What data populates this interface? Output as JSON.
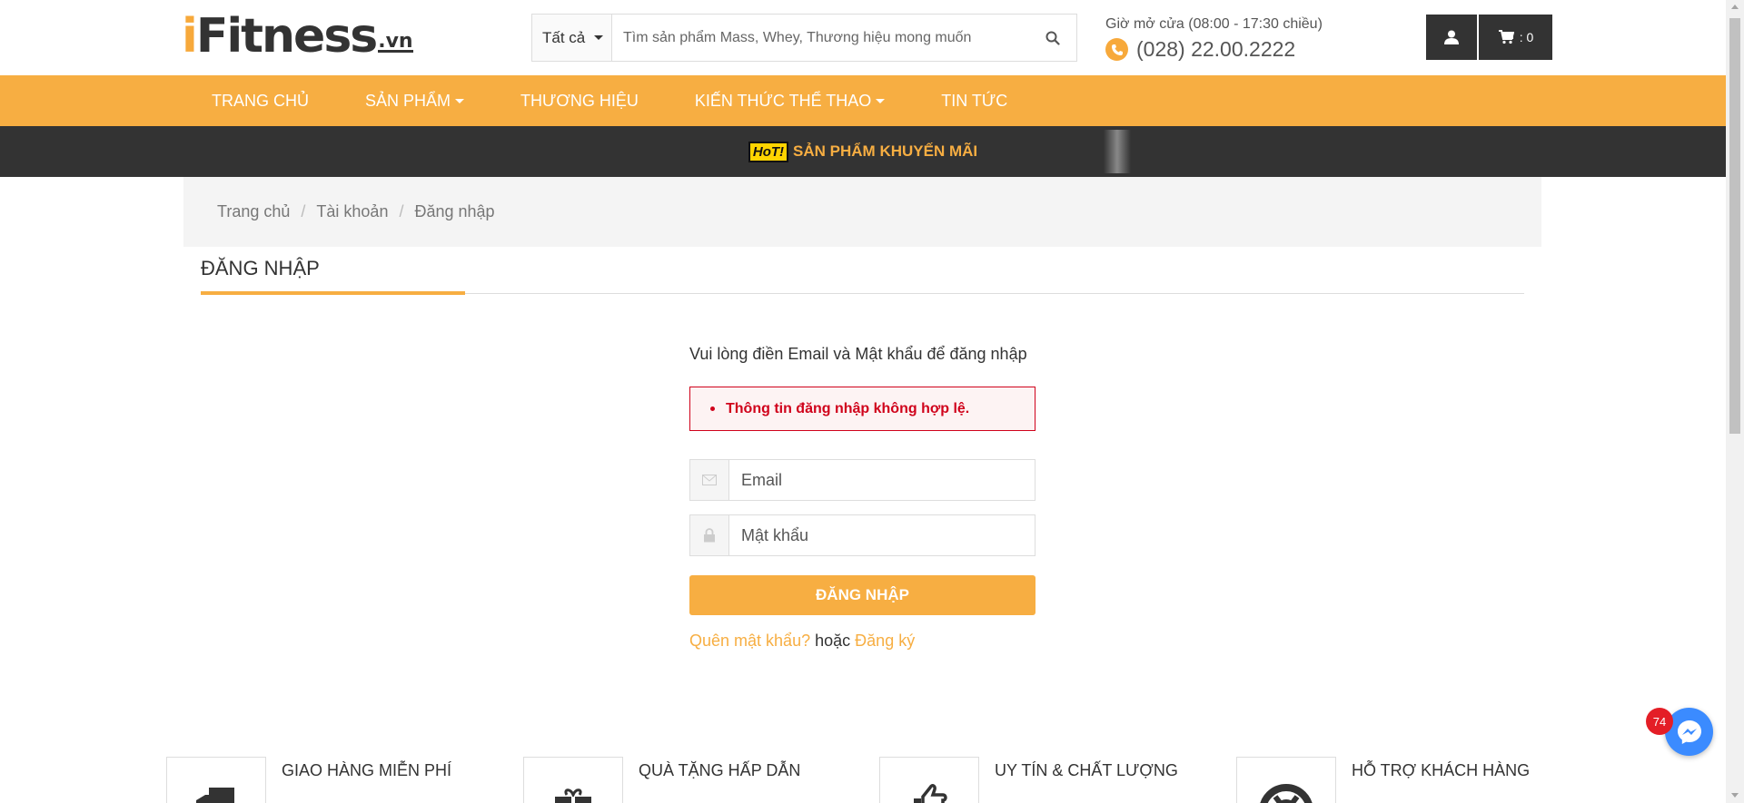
{
  "logo": {
    "prefix": "i",
    "brand": "Fitness",
    "suffix": ".vn"
  },
  "search": {
    "category": "Tất cả",
    "placeholder": "Tìm sản phẩm Mass, Whey, Thương hiệu mong muốn"
  },
  "contact": {
    "hours_label": "Giờ mở cửa (08:00 - 17:30 chiều)",
    "phone": "(028) 22.00.2222"
  },
  "cart": {
    "count": ": 0"
  },
  "nav": {
    "items": [
      {
        "label": "TRANG CHỦ",
        "dropdown": false
      },
      {
        "label": "SẢN PHẨM",
        "dropdown": true
      },
      {
        "label": "THƯƠNG HIỆU",
        "dropdown": false
      },
      {
        "label": "KIẾN THỨC THỂ THAO",
        "dropdown": true
      },
      {
        "label": "TIN TỨC",
        "dropdown": false
      }
    ]
  },
  "promo": {
    "hot": "HoT!",
    "text": "SẢN PHẨM KHUYẾN MÃI"
  },
  "breadcrumb": [
    "Trang chủ",
    "Tài khoản",
    "Đăng nhập"
  ],
  "page": {
    "title": "ĐĂNG NHẬP"
  },
  "login": {
    "intro": "Vui lòng điền Email và Mật khẩu để đăng nhập",
    "error": "Thông tin đăng nhập không hợp lệ.",
    "email_placeholder": "Email",
    "password_placeholder": "Mật khẩu",
    "submit_label": "ĐĂNG NHẬP",
    "forgot_label": "Quên mật khẩu?",
    "or_label": "hoặc",
    "register_label": "Đăng ký"
  },
  "features": [
    {
      "label": "GIAO HÀNG MIỄN PHÍ",
      "icon": "truck-icon"
    },
    {
      "label": "QUÀ TẶNG HẤP DẪN",
      "icon": "gift-icon"
    },
    {
      "label": "UY TÍN & CHẤT LƯỢNG",
      "icon": "thumbs-up-icon"
    },
    {
      "label": "HỖ TRỢ KHÁCH HÀNG",
      "icon": "lifebuoy-icon"
    }
  ],
  "messenger": {
    "badge": "74"
  },
  "colors": {
    "accent": "#f7ae42",
    "dark": "#333333",
    "error": "#d0021b",
    "messenger": "#3b8bff"
  }
}
